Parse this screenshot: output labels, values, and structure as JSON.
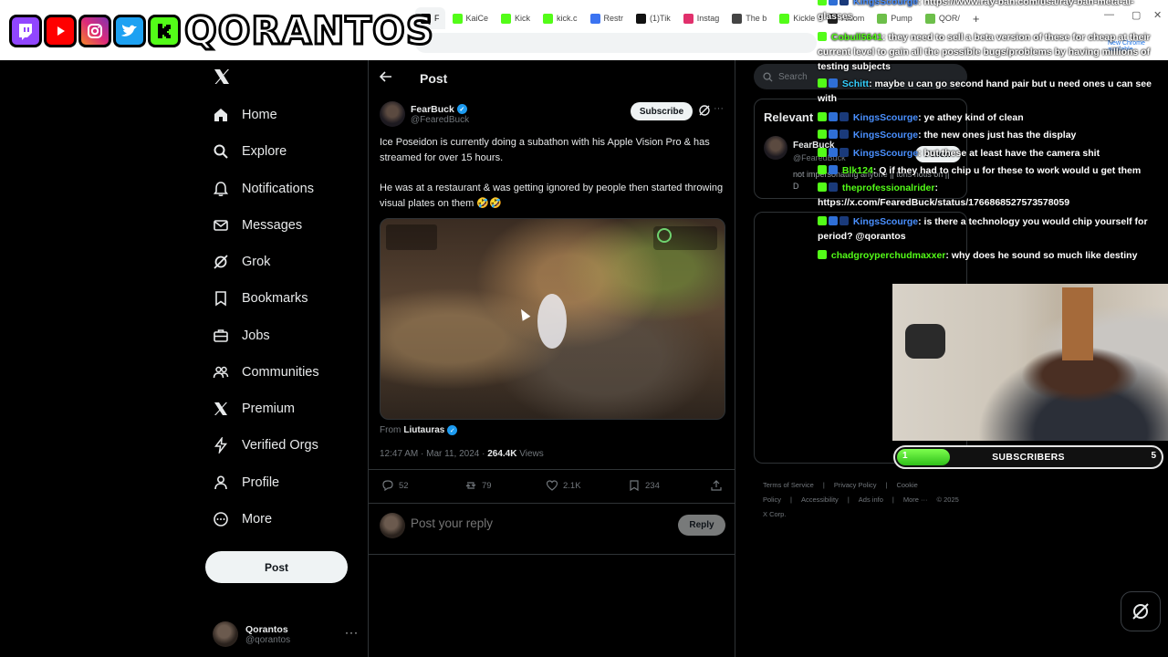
{
  "overlay": {
    "channel_name": "QORANTOS",
    "platform_icons": [
      "twitch-icon",
      "youtube-icon",
      "instagram-icon",
      "twitter-bird-icon",
      "kick-icon"
    ],
    "colors": {
      "twitch": "#9146ff",
      "youtube": "#ff0000",
      "instagram": "#e1306c",
      "twitter": "#1da1f2",
      "kick": "#53fc18"
    }
  },
  "browser": {
    "tabs": [
      {
        "label": "F",
        "icon": "x-icon",
        "active": true
      },
      {
        "label": "KaiCe",
        "icon": "kick-icon"
      },
      {
        "label": "Kick",
        "icon": "kick-icon"
      },
      {
        "label": "kick.c",
        "icon": "kick-icon"
      },
      {
        "label": "Restr",
        "icon": "restream-icon"
      },
      {
        "label": "(1)Tik",
        "icon": "tiktok-icon"
      },
      {
        "label": "Instag",
        "icon": "instagram-icon"
      },
      {
        "label": "The b",
        "icon": "bookmark-icon"
      },
      {
        "label": "Kickle",
        "icon": "kick-icon"
      },
      {
        "label": "Axiom",
        "icon": "axiom-icon"
      },
      {
        "label": "Pump",
        "icon": "pump-icon"
      },
      {
        "label": "QOR/",
        "icon": "chart-icon"
      }
    ],
    "new_tab": "+",
    "update_badge": "New Chrome available"
  },
  "sidebar": {
    "items": [
      {
        "label": "Home",
        "icon": "home-icon",
        "name": "sidebar-item-home"
      },
      {
        "label": "Explore",
        "icon": "search-icon",
        "name": "sidebar-item-explore"
      },
      {
        "label": "Notifications",
        "icon": "bell-icon",
        "name": "sidebar-item-notifications"
      },
      {
        "label": "Messages",
        "icon": "mail-icon",
        "name": "sidebar-item-messages"
      },
      {
        "label": "Grok",
        "icon": "grok-icon",
        "name": "sidebar-item-grok"
      },
      {
        "label": "Bookmarks",
        "icon": "bookmark-icon",
        "name": "sidebar-item-bookmarks"
      },
      {
        "label": "Jobs",
        "icon": "briefcase-icon",
        "name": "sidebar-item-jobs"
      },
      {
        "label": "Communities",
        "icon": "people-icon",
        "name": "sidebar-item-communities"
      },
      {
        "label": "Premium",
        "icon": "x-icon",
        "name": "sidebar-item-premium"
      },
      {
        "label": "Verified Orgs",
        "icon": "lightning-icon",
        "name": "sidebar-item-verified-orgs"
      },
      {
        "label": "Profile",
        "icon": "person-icon",
        "name": "sidebar-item-profile"
      },
      {
        "label": "More",
        "icon": "more-circle-icon",
        "name": "sidebar-item-more"
      }
    ],
    "post_label": "Post",
    "account": {
      "name": "Qorantos",
      "handle": "@qorantos",
      "more": "···"
    }
  },
  "main": {
    "title": "Post",
    "author": {
      "name": "FearBuck",
      "handle": "@FearedBuck"
    },
    "subscribe_label": "Subscribe",
    "text_1": "Ice Poseidon is currently doing a subathon with his Apple Vision Pro & has streamed for over 15 hours.",
    "text_2": "He was at a restaurant & was getting ignored by people then started throwing visual plates on them 🤣🤣",
    "from_label": "From",
    "from_user": "Liutauras",
    "timestamp": "12:47 AM · Mar 11, 2024 · ",
    "views_count": "264.4K",
    "views_label": " Views",
    "stats": {
      "replies": "52",
      "reposts": "79",
      "likes": "2.1K",
      "bookmarks": "234"
    },
    "reply_placeholder": "Post your reply",
    "reply_label": "Reply"
  },
  "right": {
    "search_placeholder": "Search",
    "relevant_title": "Relevant",
    "relevant_user": {
      "name": "FearBuck",
      "handle": "@FearedBuck",
      "follow_label": "Follow",
      "bio": "not impersonating anyone || tons notis on || D"
    },
    "footer": [
      "Terms of Service",
      "|",
      "Privacy Policy",
      "|",
      "Cookie Policy",
      "|",
      "Accessibility",
      "|",
      "Ads info",
      "|",
      "More ···",
      "© 2025 X Corp."
    ]
  },
  "chat": [
    {
      "user": "KingsScourge",
      "msg": ": https://www.ray-ban.com/usa/ray-ban-meta-ai-glasses",
      "color": "blue",
      "badges": [
        "kick",
        "mod",
        "sub"
      ]
    },
    {
      "user": "Cobull5641",
      "msg": ": they need to sell a beta version of these for cheap at their current level to gain all the possible bugs/problems by having millions of testing subjects",
      "color": "green",
      "badges": [
        "kick"
      ]
    },
    {
      "user": "Schitt",
      "msg": ": maybe u can go second hand pair but u need ones u can see with",
      "color": "cyan",
      "badges": [
        "kick",
        "mod"
      ]
    },
    {
      "user": "KingsScourge",
      "msg": ": ye athey kind of clean",
      "color": "blue",
      "badges": [
        "kick",
        "mod",
        "sub"
      ]
    },
    {
      "user": "KingsScourge",
      "msg": ": the new ones just has the display",
      "color": "blue",
      "badges": [
        "kick",
        "mod",
        "sub"
      ]
    },
    {
      "user": "KingsScourge",
      "msg": ": but these at least have the camera shit",
      "color": "blue",
      "badges": [
        "kick",
        "mod",
        "sub"
      ]
    },
    {
      "user": "Blk124",
      "msg": ": Q if they had to chip u for these to work would u get them",
      "color": "green",
      "badges": [
        "kick",
        "mod"
      ]
    },
    {
      "user": "theprofessionalrider",
      "msg": ": https://x.com/FearedBuck/status/1766868527573578059",
      "color": "green",
      "badges": [
        "kick",
        "sub"
      ]
    },
    {
      "user": "KingsScourge",
      "msg": ": is there a technology you would chip yourself for period? @qorantos",
      "color": "blue",
      "badges": [
        "kick",
        "mod",
        "sub"
      ]
    },
    {
      "user": "chadgroyperchudmaxxer",
      "msg": ": why does he sound so much like destiny",
      "color": "green",
      "badges": [
        "kick"
      ]
    }
  ],
  "subscribers": {
    "label": "SUBSCRIBERS",
    "start": "1",
    "goal": "5",
    "progress_fraction": 0.2
  }
}
